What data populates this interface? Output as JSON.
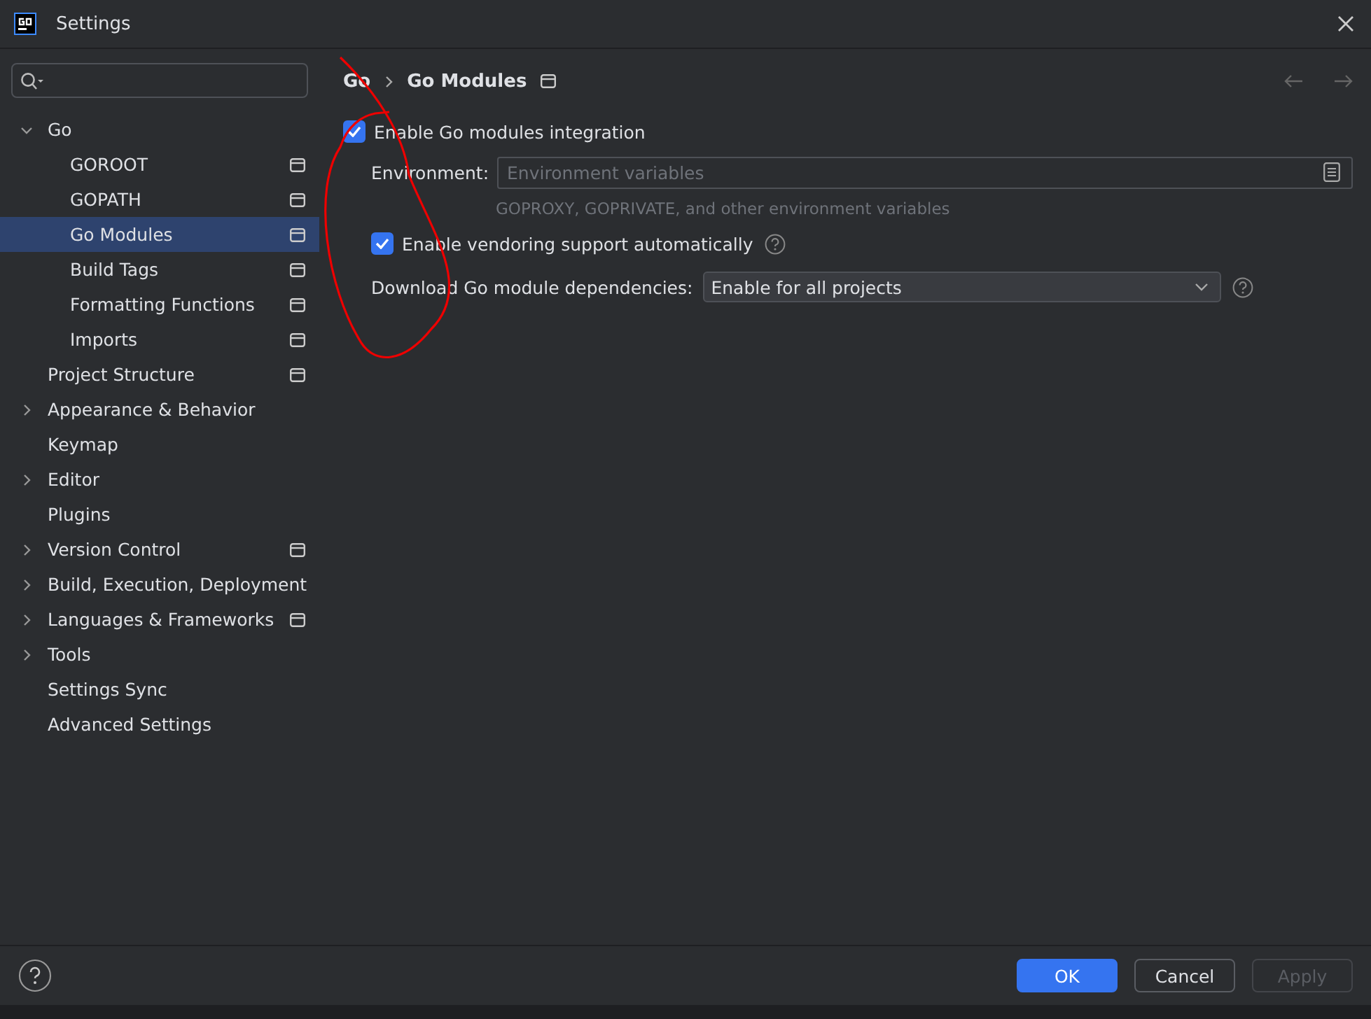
{
  "window": {
    "title": "Settings"
  },
  "sidebar": {
    "items": [
      {
        "label": "Go",
        "expanded": true,
        "selected": false,
        "project_icon": false,
        "children": [
          {
            "label": "GOROOT",
            "selected": false,
            "project_icon": true
          },
          {
            "label": "GOPATH",
            "selected": false,
            "project_icon": true
          },
          {
            "label": "Go Modules",
            "selected": true,
            "project_icon": true
          },
          {
            "label": "Build Tags",
            "selected": false,
            "project_icon": true
          },
          {
            "label": "Formatting Functions",
            "selected": false,
            "project_icon": true
          },
          {
            "label": "Imports",
            "selected": false,
            "project_icon": true
          }
        ]
      },
      {
        "label": "Project Structure",
        "selected": false,
        "project_icon": true
      },
      {
        "label": "Appearance & Behavior",
        "expanded": false,
        "selected": false,
        "project_icon": false
      },
      {
        "label": "Keymap",
        "selected": false,
        "project_icon": false
      },
      {
        "label": "Editor",
        "expanded": false,
        "selected": false,
        "project_icon": false
      },
      {
        "label": "Plugins",
        "selected": false,
        "project_icon": false
      },
      {
        "label": "Version Control",
        "expanded": false,
        "selected": false,
        "project_icon": true
      },
      {
        "label": "Build, Execution, Deployment",
        "expanded": false,
        "selected": false,
        "project_icon": false
      },
      {
        "label": "Languages & Frameworks",
        "expanded": false,
        "selected": false,
        "project_icon": true
      },
      {
        "label": "Tools",
        "expanded": false,
        "selected": false,
        "project_icon": false
      },
      {
        "label": "Settings Sync",
        "selected": false,
        "project_icon": false
      },
      {
        "label": "Advanced Settings",
        "selected": false,
        "project_icon": false
      }
    ]
  },
  "breadcrumb": [
    "Go",
    "Go Modules"
  ],
  "settings": {
    "modules_integration": {
      "label": "Enable Go modules integration",
      "checked": true
    },
    "environment": {
      "label": "Environment:",
      "placeholder": "Environment variables",
      "hint": "GOPROXY, GOPRIVATE, and other environment variables"
    },
    "vendoring": {
      "label": "Enable vendoring support automatically",
      "checked": true
    },
    "download": {
      "label": "Download Go module dependencies:",
      "value": "Enable for all projects"
    }
  },
  "buttons": [
    {
      "label": "OK",
      "kind": "primary",
      "disabled": false
    },
    {
      "label": "Cancel",
      "kind": "normal",
      "disabled": false
    },
    {
      "label": "Apply",
      "kind": "normal",
      "disabled": true
    }
  ]
}
